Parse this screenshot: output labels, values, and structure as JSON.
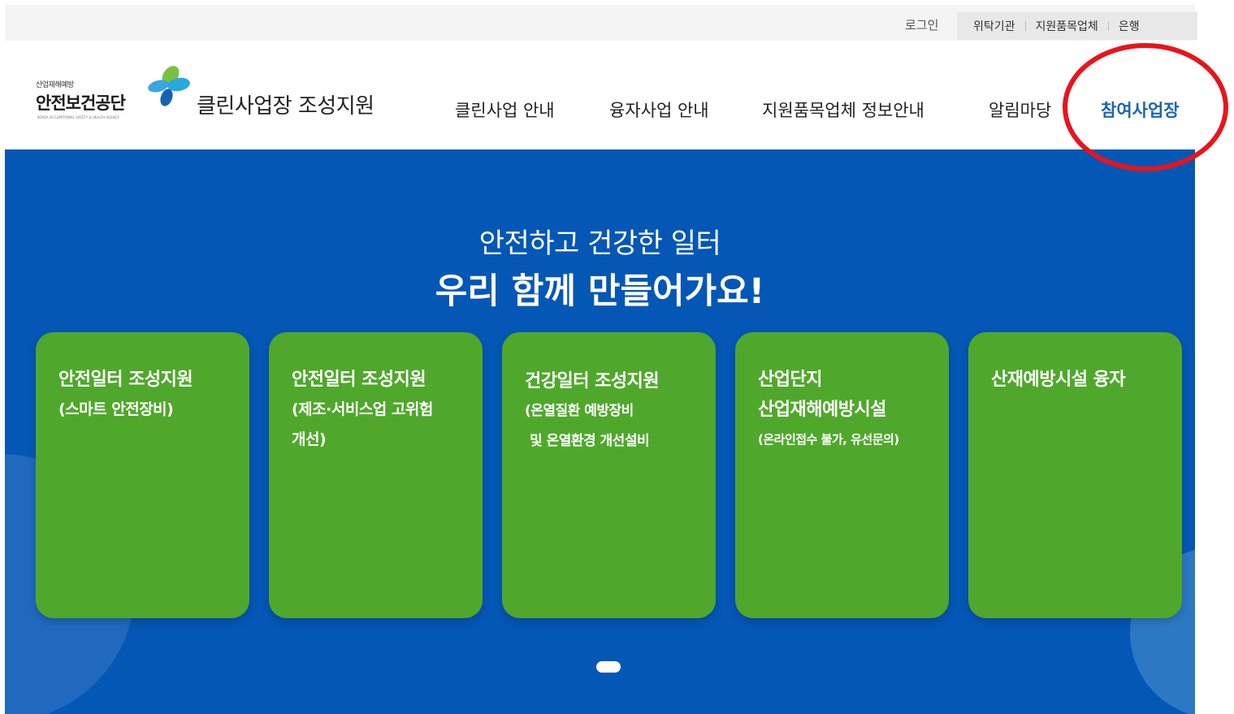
{
  "utility": {
    "login": "로그인",
    "links": [
      "위탁기관",
      "지원품목업체",
      "은행"
    ]
  },
  "logo": {
    "small": "산업재해예방",
    "main": "안전보건공단",
    "english": "KOREA OCCUPATIONAL SAFETY & HEALTH AGENCY"
  },
  "site_title": "클린사업장 조성지원",
  "nav": {
    "items": [
      "클린사업 안내",
      "융자사업 안내",
      "지원품목업체 정보안내",
      "알림마당",
      "참여사업장"
    ],
    "active_item": "참여사업장"
  },
  "hero": {
    "subtitle": "안전하고 건강한 일터",
    "title": "우리 함께 만들어가요!"
  },
  "cards": [
    {
      "title": "안전일터 조성지원",
      "lines": [
        "(스마트 안전장비)"
      ]
    },
    {
      "title": "안전일터 조성지원",
      "lines": [
        "(제조·서비스업 고위험",
        "개선)"
      ]
    },
    {
      "title": "건강일터 조성지원",
      "lines": [
        "(온열질환 예방장비",
        "및 온열환경 개선설비"
      ]
    },
    {
      "title": "산업단지",
      "lines": [
        "산업재해예방시설",
        "(온라인접수 불가, 유선문의)"
      ]
    },
    {
      "title": "산재예방시설 융자",
      "lines": []
    }
  ],
  "carousel": {
    "pages": 1,
    "current": 1
  },
  "colors": {
    "hero_background": "#0557b6",
    "card_green": "#4fa82b",
    "active_nav": "#1d64b8",
    "annotation_red": "#e8141b"
  }
}
